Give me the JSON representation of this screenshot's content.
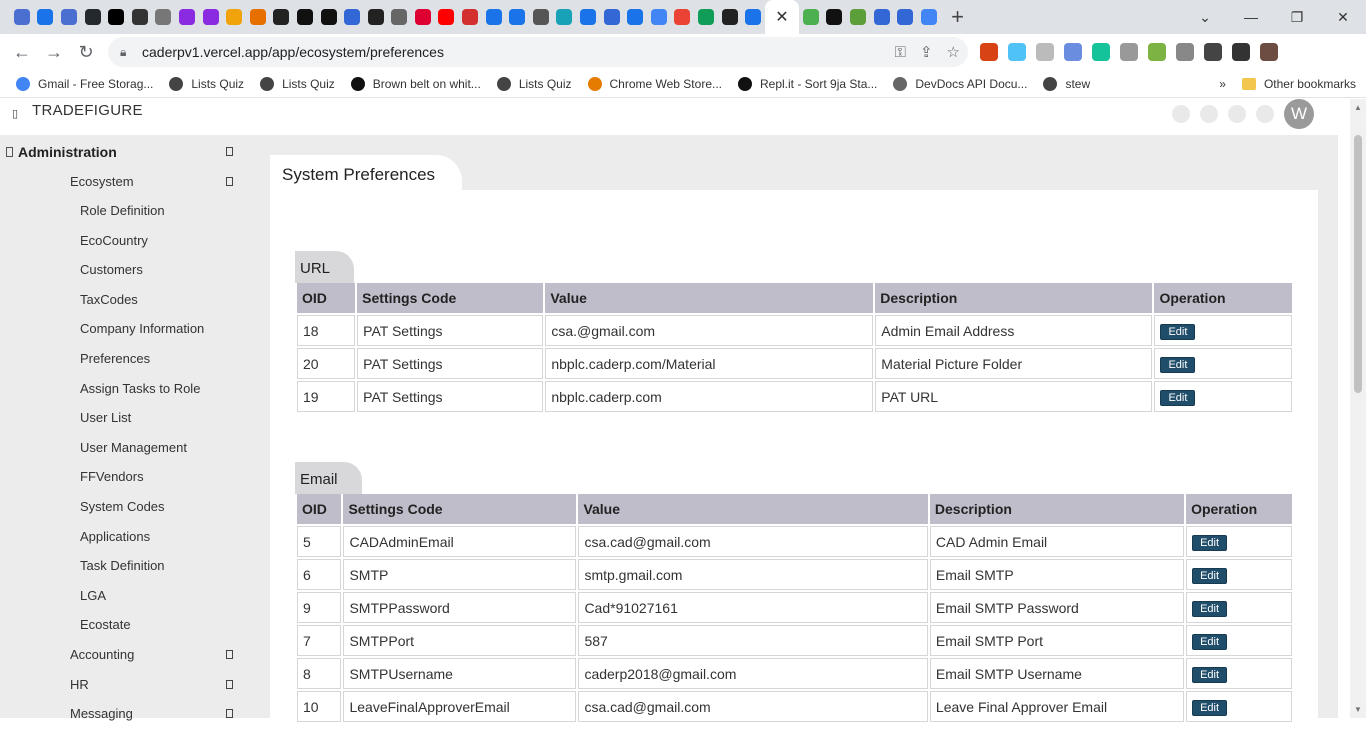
{
  "browser": {
    "url": "caderpv1.vercel.app/app/ecosystem/preferences",
    "active_tab_close": "✕",
    "new_tab": "+",
    "bookmarks": [
      {
        "label": "Gmail - Free Storag..."
      },
      {
        "label": "Lists Quiz"
      },
      {
        "label": "Lists Quiz"
      },
      {
        "label": "Brown belt on whit..."
      },
      {
        "label": "Lists Quiz"
      },
      {
        "label": "Chrome Web Store..."
      },
      {
        "label": "Repl.it - Sort 9ja Sta..."
      },
      {
        "label": "DevDocs API Docu..."
      },
      {
        "label": "stew"
      }
    ],
    "other_bookmarks": "Other bookmarks",
    "more_bookmarks": "»"
  },
  "app": {
    "brand": "TRADEFIGURE",
    "avatar_initial": "W",
    "page_title": "System Preferences"
  },
  "sidebar": {
    "section": "Administration",
    "group": "Ecosystem",
    "items": [
      "Role Definition",
      "EcoCountry",
      "Customers",
      "TaxCodes",
      "Company Information",
      "Preferences",
      "Assign Tasks to Role",
      "User List",
      "User Management",
      "FFVendors",
      "System Codes",
      "Applications",
      "Task Definition",
      "LGA",
      "Ecostate"
    ],
    "groups_after": [
      "Accounting",
      "HR",
      "Messaging"
    ]
  },
  "url_section": {
    "title": "URL",
    "columns": [
      "OID",
      "Settings Code",
      "Value",
      "Description",
      "Operation"
    ],
    "rows": [
      {
        "oid": "18",
        "code": "PAT Settings",
        "value": "csa.@gmail.com",
        "desc": "Admin Email Address",
        "op": "Edit"
      },
      {
        "oid": "20",
        "code": "PAT Settings",
        "value": "nbplc.caderp.com/Material",
        "desc": "Material Picture Folder",
        "op": "Edit"
      },
      {
        "oid": "19",
        "code": "PAT Settings",
        "value": "nbplc.caderp.com",
        "desc": "PAT URL",
        "op": "Edit"
      }
    ]
  },
  "email_section": {
    "title": "Email",
    "columns": [
      "OID",
      "Settings Code",
      "Value",
      "Description",
      "Operation"
    ],
    "rows": [
      {
        "oid": "5",
        "code": "CADAdminEmail",
        "value": "csa.cad@gmail.com",
        "desc": "CAD Admin Email",
        "op": "Edit"
      },
      {
        "oid": "6",
        "code": "SMTP",
        "value": "smtp.gmail.com",
        "desc": "Email SMTP",
        "op": "Edit"
      },
      {
        "oid": "9",
        "code": "SMTPPassword",
        "value": "Cad*91027161",
        "desc": "Email SMTP Password",
        "op": "Edit"
      },
      {
        "oid": "7",
        "code": "SMTPPort",
        "value": "587",
        "desc": "Email SMTP Port",
        "op": "Edit"
      },
      {
        "oid": "8",
        "code": "SMTPUsername",
        "value": "caderp2018@gmail.com",
        "desc": "Email SMTP Username",
        "op": "Edit"
      },
      {
        "oid": "10",
        "code": "LeaveFinalApproverEmail",
        "value": "csa.cad@gmail.com",
        "desc": "Leave Final Approver Email",
        "op": "Edit"
      }
    ]
  }
}
